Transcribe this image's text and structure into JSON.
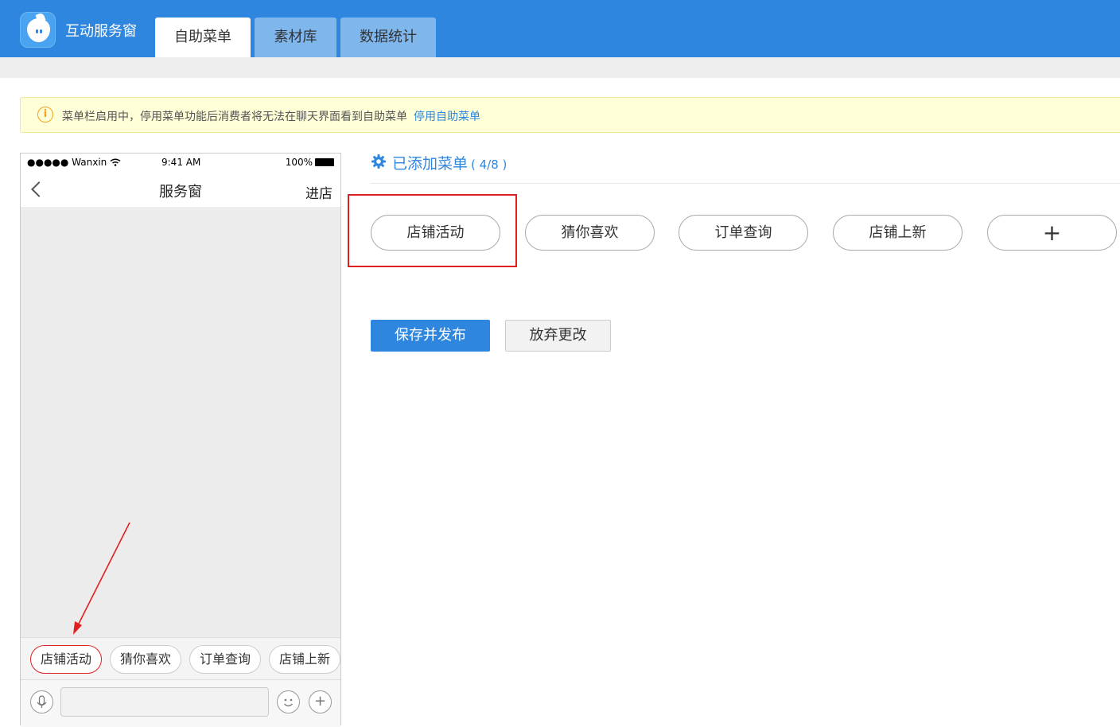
{
  "app": {
    "title": "互动服务窗"
  },
  "tabs": [
    {
      "label": "自助菜单",
      "active": true
    },
    {
      "label": "素材库",
      "active": false
    },
    {
      "label": "数据统计",
      "active": false
    }
  ],
  "notice": {
    "message": "菜单栏启用中，停用菜单功能后消费者将无法在聊天界面看到自助菜单",
    "link": "停用自助菜单"
  },
  "phone": {
    "status": {
      "carrier": "●●●●● Wanxin",
      "time": "9:41 AM",
      "battery": "100%"
    },
    "nav": {
      "title": "服务窗",
      "right": "进店"
    },
    "menu_chips": [
      "店铺活动",
      "猜你喜欢",
      "订单查询",
      "店铺上新"
    ],
    "input_buttons": {
      "mic": "🎙",
      "emoji": "☺",
      "plus": "+"
    }
  },
  "section": {
    "title": "已添加菜单",
    "count": "( 4/8 )"
  },
  "menus": [
    "店铺活动",
    "猜你喜欢",
    "订单查询",
    "店铺上新"
  ],
  "add_label": "+",
  "actions": {
    "save": "保存并发布",
    "discard": "放弃更改"
  },
  "colors": {
    "brand": "#2e86de",
    "highlight": "#e02020",
    "notice_bg": "#ffffd8"
  }
}
